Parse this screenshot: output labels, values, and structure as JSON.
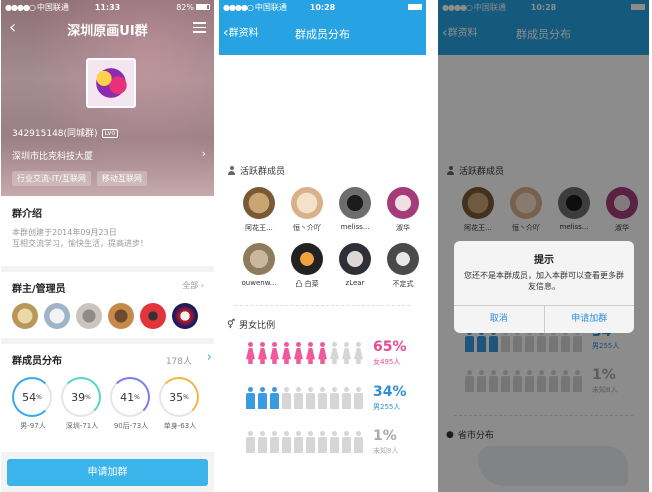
{
  "screen1": {
    "status": {
      "carrier": "中国联通",
      "time": "11:33",
      "battery": "82%",
      "battery_level": 0.82
    },
    "nav_title": "深圳原画UI群",
    "group_id": "342915148(同城群)",
    "level_badge": "LV0",
    "company": "深圳市比克科技大厦",
    "tags": [
      "行业交流-IT/互联网",
      "移动互联网"
    ],
    "intro_title": "群介绍",
    "intro_lines": [
      "本群创建于2014年09月23日",
      "互相交流学习，愉快生活，提高进步！"
    ],
    "admins_title": "群主/管理员",
    "admins_all": "全部",
    "dist_title": "群成员分布",
    "dist_count": "178人",
    "rings": [
      {
        "value": "54",
        "unit": "%",
        "label": "男-97人"
      },
      {
        "value": "39",
        "unit": "%",
        "label": "深圳-71人"
      },
      {
        "value": "41",
        "unit": "%",
        "label": "90后-73人"
      },
      {
        "value": "35",
        "unit": "%",
        "label": "单身-63人"
      }
    ],
    "apply_button": "申请加群"
  },
  "screen2": {
    "status": {
      "carrier": "中国联通",
      "time": "10:28"
    },
    "back_label": "群资料",
    "title": "群成员分布",
    "active_title": "活跃群成员",
    "members": [
      "阿花王...",
      "恒丶介吖",
      "meliss...",
      "淑华",
      "ouwenw...",
      "凸 白菜",
      "zLear",
      "不定式"
    ],
    "gender_title": "男女比例",
    "female": {
      "pct": "65%",
      "sub": "女495人",
      "ratio": 0.65
    },
    "male": {
      "pct": "34%",
      "sub": "男255人",
      "ratio": 0.34
    },
    "unknown": {
      "pct": "1%",
      "sub": "未知8人",
      "ratio": 0.01
    }
  },
  "screen3": {
    "status": {
      "carrier": "中国联通",
      "time": "10:28"
    },
    "back_label": "群资料",
    "title": "群成员分布",
    "active_title": "活跃群成员",
    "members": [
      "阿花王...",
      "恒丶介吖",
      "meliss...",
      "淑华"
    ],
    "male_sub": "男255人",
    "unknown_pct": "1%",
    "unknown_sub": "未知8人",
    "male_pct_partial": "34",
    "province_title": "省市分布",
    "dialog": {
      "title": "提示",
      "message": "您还不是本群成员，加入本群可以查看更多群友信息。",
      "cancel": "取消",
      "apply": "申请加群"
    }
  }
}
